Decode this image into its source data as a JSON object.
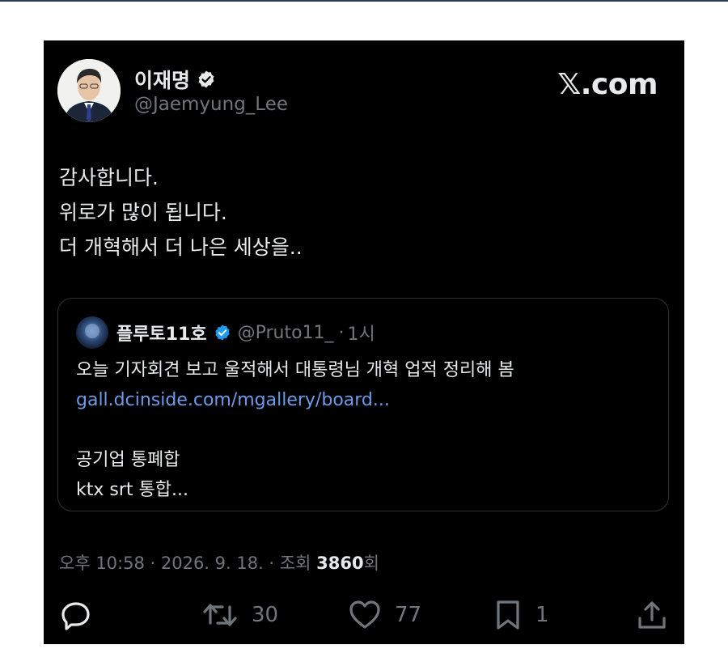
{
  "author": {
    "name": "이재명",
    "handle": "@Jaemyung_Lee",
    "verified": true
  },
  "brand": {
    "logo_text": "𝕏.com"
  },
  "tweet": {
    "lines": [
      "감사합니다.",
      "위로가 많이 됩니다.",
      "더 개혁해서 더 나은 세상을.."
    ]
  },
  "quote": {
    "name": "플루토11호",
    "handle": "@Pruto11_",
    "separator": "·",
    "time": "1시",
    "lines": [
      "오늘 기자회견 보고 울적해서 대통령님 개혁 업적 정리해 봄"
    ],
    "link": "gall.dcinside.com/mgallery/board...",
    "lines2": [
      "공기업 통폐합",
      "ktx srt 통합..."
    ]
  },
  "meta": {
    "prefix": "오후 10:58 · 2026. 9. 18. · 조회 ",
    "views": "3860",
    "suffix": "회"
  },
  "actions": {
    "reply_count": "",
    "retweet_count": "30",
    "like_count": "77",
    "bookmark_count": "1"
  },
  "colors": {
    "card_bg": "#000000",
    "text": "#e7e9ea",
    "muted": "#71767b",
    "link": "#6f9ae6",
    "verified": "#1d9bf0",
    "border": "#2f3336"
  }
}
